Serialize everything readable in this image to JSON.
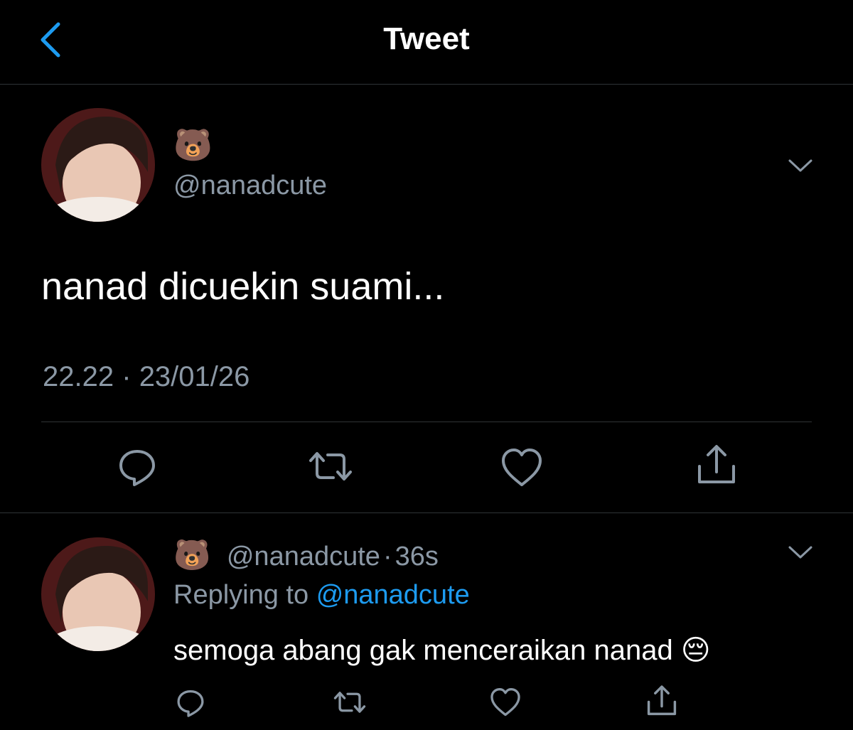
{
  "header": {
    "title": "Tweet"
  },
  "main_tweet": {
    "display_name_emoji": "🐻",
    "handle": "@nanadcute",
    "text": "nanad dicuekin suami...",
    "time": "22.22",
    "separator": "·",
    "date": "23/01/26"
  },
  "reply": {
    "display_name_emoji": "🐻",
    "handle": "@nanadcute",
    "dot": "·",
    "age": "36s",
    "replying_prefix": "Replying to",
    "replying_handle": "@nanadcute",
    "text": "semoga abang gak menceraikan nanad",
    "text_emoji": "😔"
  },
  "colors": {
    "background": "#000000",
    "accent": "#1d9bf0",
    "muted": "#8b98a5",
    "divider": "#2f3336"
  },
  "icons": [
    "back-chevron-icon",
    "chevron-down-icon",
    "reply-icon",
    "retweet-icon",
    "like-icon",
    "share-icon"
  ]
}
